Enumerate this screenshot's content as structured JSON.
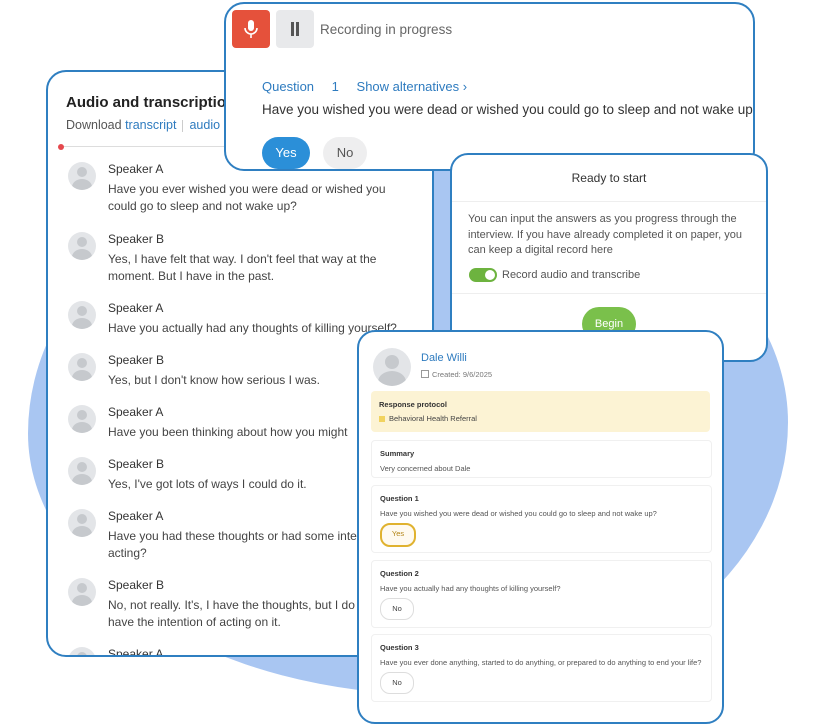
{
  "transcript_panel": {
    "title": "Audio and transcriptio",
    "download_label": "Download",
    "transcript_link": "transcript",
    "audio_link": "audio",
    "entries": [
      {
        "speaker": "Speaker A",
        "text": "Have you ever wished you were dead or wished you could go to sleep and not wake up?"
      },
      {
        "speaker": "Speaker B",
        "text": "Yes, I have felt that way. I don't feel that way at the moment. But I have in the past."
      },
      {
        "speaker": "Speaker A",
        "text": "Have you actually had any thoughts of killing yourself?"
      },
      {
        "speaker": "Speaker B",
        "text": "Yes, but I don't know how serious I was."
      },
      {
        "speaker": "Speaker A",
        "text": "Have you been thinking about how you might"
      },
      {
        "speaker": "Speaker B",
        "text": "Yes, I've got lots of ways I could do it."
      },
      {
        "speaker": "Speaker A",
        "text": "Have you had these thoughts or had some inte acting?"
      },
      {
        "speaker": "Speaker B",
        "text": "No, not really. It's, I have the thoughts, but I do have the intention of acting on it."
      },
      {
        "speaker": "Speaker A",
        "text": ""
      }
    ]
  },
  "recording_panel": {
    "mic_icon": "microphone-icon",
    "pause_icon": "pause-icon",
    "status": "Recording in progress",
    "question_label": "Question",
    "question_number": "1",
    "show_alternatives": "Show alternatives",
    "question_text": "Have you wished you were dead or wished you could go to sleep and not wake up?",
    "yes_label": "Yes",
    "no_label": "No",
    "colors": {
      "mic": "#e5513b",
      "yes": "#2b8fd8"
    }
  },
  "ready_panel": {
    "title": "Ready to start",
    "description": "You can input the answers as you progress through the interview. If you have already completed it on paper, you can keep a digital record here",
    "toggle_label": "Record audio and transcribe",
    "toggle_on": true,
    "begin_label": "Begin",
    "colors": {
      "begin": "#7ac04b"
    }
  },
  "patient_panel": {
    "name": "Dale Willi",
    "created": "Created: 9/6/2025",
    "protocol_label": "Response protocol",
    "protocol_value": "Behavioral Health Referral",
    "summary_label": "Summary",
    "summary_text": "Very concerned about Dale",
    "questions": [
      {
        "label": "Question 1",
        "text": "Have you wished you were dead or wished you could go to sleep and not wake up?",
        "answer": "Yes"
      },
      {
        "label": "Question 2",
        "text": "Have you actually had any thoughts of killing yourself?",
        "answer": "No"
      },
      {
        "label": "Question 3",
        "text": "Have you ever done anything, started to do anything, or prepared to do anything to end your life?",
        "answer": "No"
      }
    ]
  }
}
